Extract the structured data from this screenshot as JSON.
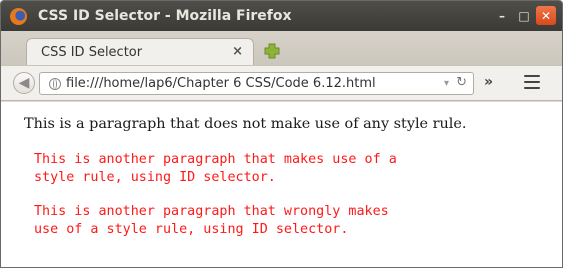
{
  "window": {
    "title": "CSS ID Selector - Mozilla Firefox",
    "controls": {
      "minimize": "–",
      "maximize": "□",
      "close": "✕"
    }
  },
  "tabs": [
    {
      "label": "CSS ID Selector",
      "close": "×"
    }
  ],
  "navbar": {
    "url": "file:///home/lap6/Chapter 6 CSS/Code 6.12.html",
    "overflow": "»"
  },
  "content": {
    "paragraph_plain": "This is a paragraph that does not make use of any style rule.",
    "paragraph_id_1": {
      "line1": "This is another paragraph that makes use of a",
      "line2": "style rule, using ID selector."
    },
    "paragraph_id_2": {
      "line1": "This is another paragraph that wrongly makes",
      "line2": "use of a style rule, using ID selector."
    }
  },
  "colors": {
    "accent_red": "#ff1a1a",
    "titlebar": "#3b3a36",
    "close_button": "#d84a1b"
  }
}
